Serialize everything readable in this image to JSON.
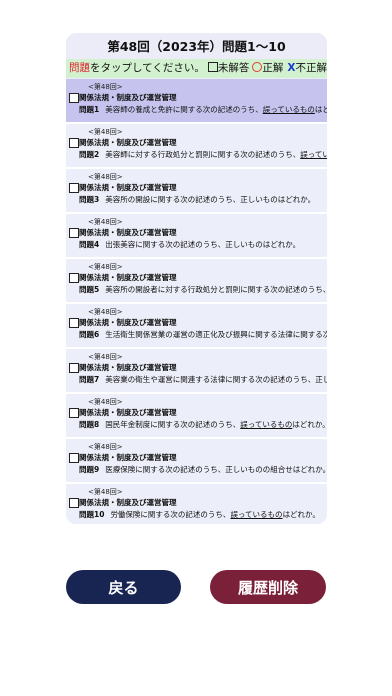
{
  "header": {
    "title": "第48回（2023年）問題1〜10"
  },
  "legend": {
    "tap_word": "問題",
    "tap_rest": "をタップしてください。",
    "unanswered": "未解答",
    "correct": "正解",
    "wrong_mark": "X",
    "wrong": "不正解"
  },
  "questions": [
    {
      "session": "<第48回>",
      "category": "関係法規・制度及び運営管理",
      "number": "問題1",
      "text_a": "美容師の養成と免許に関する次の記述のうち、",
      "text_u": "誤っているもの",
      "text_b": "はどれ"
    },
    {
      "session": "<第48回>",
      "category": "関係法規・制度及び運営管理",
      "number": "問題2",
      "text_a": "美容師に対する行政処分と罰則に関する次の記述のうち、",
      "text_u": "誤っている",
      "text_b": ""
    },
    {
      "session": "<第48回>",
      "category": "関係法規・制度及び運営管理",
      "number": "問題3",
      "text_a": "美容所の開設に関する次の記述のうち、正しいものはどれか。",
      "text_u": "",
      "text_b": ""
    },
    {
      "session": "<第48回>",
      "category": "関係法規・制度及び運営管理",
      "number": "問題4",
      "text_a": "出張美容に関する次の記述のうち、正しいものはどれか。",
      "text_u": "",
      "text_b": ""
    },
    {
      "session": "<第48回>",
      "category": "関係法規・制度及び運営管理",
      "number": "問題5",
      "text_a": "美容所の開設者に対する行政処分と罰則に関する次の記述のうち、正",
      "text_u": "",
      "text_b": ""
    },
    {
      "session": "<第48回>",
      "category": "関係法規・制度及び運営管理",
      "number": "問題6",
      "text_a": "生活衛生関係営業の運営の適正化及び振興に関する法律に関する次の",
      "text_u": "",
      "text_b": ""
    },
    {
      "session": "<第48回>",
      "category": "関係法規・制度及び運営管理",
      "number": "問題7",
      "text_a": "美容業の衛生や運営に関連する法律に関する次の記述のうち、正しい",
      "text_u": "",
      "text_b": ""
    },
    {
      "session": "<第48回>",
      "category": "関係法規・制度及び運営管理",
      "number": "問題8",
      "text_a": "国民年金制度に関する次の記述のうち、",
      "text_u": "誤っているもの",
      "text_b": "はどれか。"
    },
    {
      "session": "<第48回>",
      "category": "関係法規・制度及び運営管理",
      "number": "問題9",
      "text_a": "医療保険に関する次の記述のうち、正しいものの組合せはどれか。",
      "text_u": "",
      "text_b": ""
    },
    {
      "session": "<第48回>",
      "category": "関係法規・制度及び運営管理",
      "number": "問題10",
      "text_a": "労働保険に関する次の記述のうち、",
      "text_u": "誤っているもの",
      "text_b": "はどれか。"
    }
  ],
  "buttons": {
    "back": "戻る",
    "delete_history": "履歴削除"
  }
}
